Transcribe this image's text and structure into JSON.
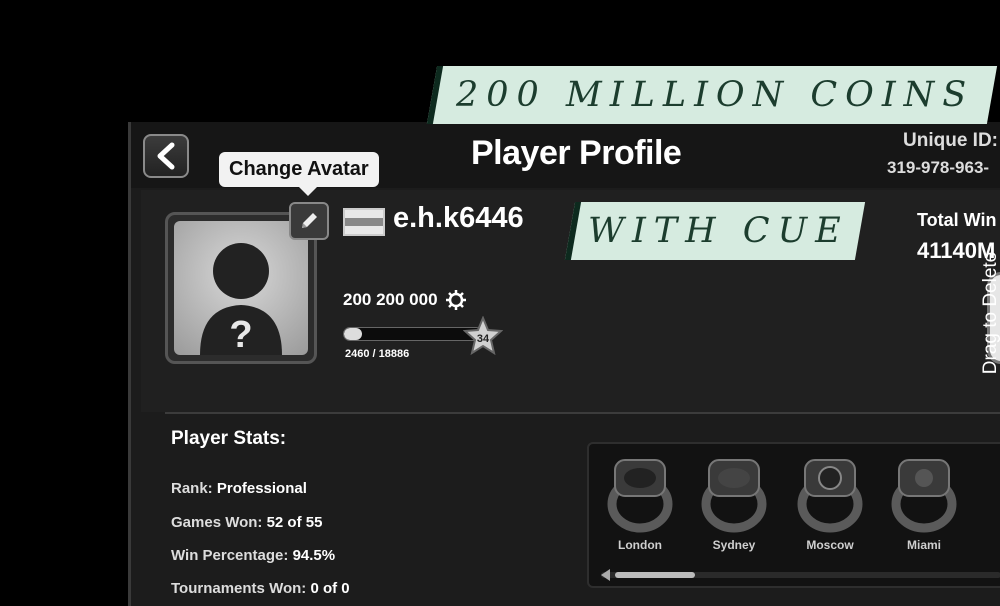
{
  "header": {
    "title": "Player Profile",
    "unique_id_label": "Unique ID:",
    "unique_id_value": "319-978-963-"
  },
  "tooltip": {
    "change_avatar": "Change Avatar"
  },
  "profile": {
    "username": "e.h.k6446",
    "coins": "200 200 000",
    "xp_text": "2460 / 18886",
    "xp_progress": 0.13,
    "level": "34",
    "total_win_label": "Total Win",
    "total_win_value": "41140M"
  },
  "overlay": {
    "drag_to_delete": "Drag to Delete"
  },
  "stats": {
    "title": "Player Stats:",
    "rank_label": "Rank:",
    "rank_value": "Professional",
    "games_won_label": "Games Won:",
    "games_won_value": "52 of 55",
    "win_pct_label": "Win Percentage:",
    "win_pct_value": "94.5%",
    "tournaments_label": "Tournaments Won:",
    "tournaments_value": "0 of 0"
  },
  "rings": [
    {
      "label": "London"
    },
    {
      "label": "Sydney"
    },
    {
      "label": "Moscow"
    },
    {
      "label": "Miami"
    }
  ],
  "banners": {
    "line1": "200 MILLION COINS",
    "line2": "WITH CUE"
  },
  "colors": {
    "banner_bg": "#d6ebe0",
    "banner_text": "#1c3d2e",
    "panel_bg": "#1c1c1c"
  }
}
